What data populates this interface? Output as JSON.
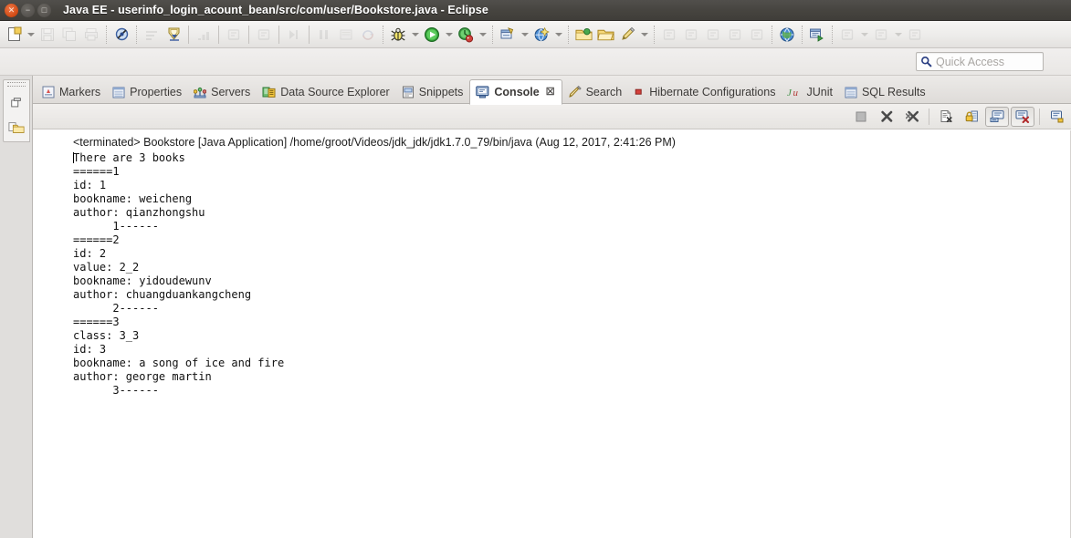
{
  "window": {
    "title": "Java EE - userinfo_login_acount_bean/src/com/user/Bookstore.java - Eclipse",
    "controls": [
      {
        "name": "close",
        "glyph": "✕"
      },
      {
        "name": "minimize",
        "glyph": "−"
      },
      {
        "name": "maximize",
        "glyph": "□"
      }
    ]
  },
  "toolbar": {
    "items": [
      {
        "name": "new-wizard-icon",
        "kind": "new",
        "enabled": true
      },
      {
        "name": "new-dropdown-arrow",
        "kind": "arrow",
        "enabled": true
      },
      {
        "name": "save-icon",
        "kind": "save",
        "enabled": false
      },
      {
        "name": "save-all-icon",
        "kind": "saveall",
        "enabled": false
      },
      {
        "name": "print-icon",
        "kind": "print",
        "enabled": false
      },
      {
        "name": "separator",
        "kind": "sep"
      },
      {
        "name": "toggle-breakpoint-icon",
        "kind": "skip",
        "enabled": true
      },
      {
        "name": "separator",
        "kind": "sep"
      },
      {
        "name": "open-type-icon",
        "kind": "opentype",
        "enabled": false
      },
      {
        "name": "validate-icon",
        "kind": "validate",
        "enabled": true
      },
      {
        "name": "separator",
        "kind": "sep-solid"
      },
      {
        "name": "run-last-tool-icon",
        "kind": "dimtool",
        "enabled": false
      },
      {
        "name": "separator",
        "kind": "sep-solid"
      },
      {
        "name": "search-dim-icon",
        "kind": "dimtool2",
        "enabled": false
      },
      {
        "name": "separator",
        "kind": "sep-solid"
      },
      {
        "name": "next-annotation-icon",
        "kind": "dimtool2",
        "enabled": false
      },
      {
        "name": "separator",
        "kind": "sep-solid"
      },
      {
        "name": "forward-icon",
        "kind": "forward",
        "enabled": false
      },
      {
        "name": "separator",
        "kind": "sep-solid"
      },
      {
        "name": "step-icon",
        "kind": "step",
        "enabled": false
      },
      {
        "name": "terminal-icon",
        "kind": "terminal",
        "enabled": false
      },
      {
        "name": "sync-icon",
        "kind": "sync",
        "enabled": false
      },
      {
        "name": "separator",
        "kind": "sep"
      },
      {
        "name": "debug-icon",
        "kind": "debug",
        "enabled": true
      },
      {
        "name": "debug-dropdown-arrow",
        "kind": "arrow",
        "enabled": true
      },
      {
        "name": "run-icon",
        "kind": "run",
        "enabled": true
      },
      {
        "name": "run-dropdown-arrow",
        "kind": "arrow",
        "enabled": true
      },
      {
        "name": "profile-icon",
        "kind": "profile",
        "enabled": true
      },
      {
        "name": "profile-dropdown-arrow",
        "kind": "arrow",
        "enabled": true
      },
      {
        "name": "separator",
        "kind": "sep"
      },
      {
        "name": "server-icon",
        "kind": "server",
        "enabled": true
      },
      {
        "name": "server-dropdown-arrow",
        "kind": "arrow",
        "enabled": true
      },
      {
        "name": "globe-blue-icon",
        "kind": "globeblue",
        "enabled": true
      },
      {
        "name": "globe-dropdown-arrow",
        "kind": "arrow",
        "enabled": true
      },
      {
        "name": "separator",
        "kind": "sep"
      },
      {
        "name": "open-folder-green-icon",
        "kind": "foldergreen",
        "enabled": true
      },
      {
        "name": "open-folder-icon",
        "kind": "folder",
        "enabled": true
      },
      {
        "name": "pencil-icon",
        "kind": "pencil",
        "enabled": true
      },
      {
        "name": "pencil-dropdown-arrow",
        "kind": "arrow",
        "enabled": true
      },
      {
        "name": "separator",
        "kind": "sep"
      },
      {
        "name": "hibernate-dim-icon",
        "kind": "dimtool2",
        "enabled": false
      },
      {
        "name": "lightning-dim-icon",
        "kind": "dimtool2",
        "enabled": false
      },
      {
        "name": "bullet-dim-icon",
        "kind": "dimtool2",
        "enabled": false
      },
      {
        "name": "table-dim-icon",
        "kind": "dimtool2",
        "enabled": false
      },
      {
        "name": "column-dim-icon",
        "kind": "dimtool2",
        "enabled": false
      },
      {
        "name": "separator",
        "kind": "sep"
      },
      {
        "name": "web-browser-icon",
        "kind": "globegreen",
        "enabled": true
      },
      {
        "name": "separator",
        "kind": "sep"
      },
      {
        "name": "deploy-icon",
        "kind": "deploy",
        "enabled": true
      },
      {
        "name": "separator",
        "kind": "sep"
      },
      {
        "name": "doc-dim-icon",
        "kind": "dimtool2",
        "enabled": false
      },
      {
        "name": "doc-dropdown-arrow",
        "kind": "arrow-dim",
        "enabled": false
      },
      {
        "name": "doc2-dim-icon",
        "kind": "dimtool2",
        "enabled": false
      },
      {
        "name": "doc2-dropdown-arrow",
        "kind": "arrow-dim",
        "enabled": false
      },
      {
        "name": "doc3-dim-icon",
        "kind": "dimtool2",
        "enabled": false
      }
    ]
  },
  "search": {
    "placeholder": "Quick Access",
    "value": "",
    "icon": "search-icon"
  },
  "fastview": {
    "items": [
      {
        "name": "restore-icon",
        "kind": "restore"
      },
      {
        "name": "project-explorer-icon",
        "kind": "folder"
      }
    ]
  },
  "tabs": [
    {
      "label": "Markers",
      "icon": "markers-icon",
      "active": false
    },
    {
      "label": "Properties",
      "icon": "properties-icon",
      "active": false
    },
    {
      "label": "Servers",
      "icon": "servers-icon",
      "active": false
    },
    {
      "label": "Data Source Explorer",
      "icon": "data-source-icon",
      "active": false
    },
    {
      "label": "Snippets",
      "icon": "snippets-icon",
      "active": false
    },
    {
      "label": "Console",
      "icon": "console-icon",
      "active": true,
      "close": "☒"
    },
    {
      "label": "Search",
      "icon": "search-tab-icon",
      "active": false
    },
    {
      "label": "Hibernate Configurations",
      "icon": "hibernate-icon",
      "active": false
    },
    {
      "label": "JUnit",
      "icon": "junit-icon",
      "active": false
    },
    {
      "label": "SQL Results",
      "icon": "sql-results-icon",
      "active": false
    }
  ],
  "console_toolbar": {
    "items": [
      {
        "name": "terminate-button",
        "kind": "terminate",
        "pressed": false
      },
      {
        "name": "remove-launch-button",
        "kind": "remove",
        "pressed": false
      },
      {
        "name": "remove-all-terminated-button",
        "kind": "removeall",
        "pressed": false
      },
      {
        "name": "separator",
        "kind": "sep"
      },
      {
        "name": "clear-console-button",
        "kind": "clear",
        "pressed": false
      },
      {
        "name": "scroll-lock-button",
        "kind": "lock",
        "pressed": false
      },
      {
        "name": "pin-console-button",
        "kind": "pin",
        "pressed": true
      },
      {
        "name": "display-selected-console-button",
        "kind": "display",
        "pressed": true
      },
      {
        "name": "separator",
        "kind": "sep"
      },
      {
        "name": "open-console-button",
        "kind": "open",
        "pressed": false
      }
    ]
  },
  "console": {
    "header": "<terminated> Bookstore [Java Application] /home/groot/Videos/jdk_jdk/jdk1.7.0_79/bin/java (Aug 12, 2017, 2:41:26 PM)",
    "lines": [
      "There are 3 books",
      "======1",
      "id: 1",
      "bookname: weicheng",
      "author: qianzhongshu",
      "      1------",
      "======2",
      "id: 2",
      "value: 2_2",
      "bookname: yidoudewunv",
      "author: chuangduankangcheng",
      "      2------",
      "======3",
      "class: 3_3",
      "id: 3",
      "bookname: a song of ice and fire",
      "author: george martin",
      "      3------"
    ]
  },
  "colors": {
    "titlebar": "#46443f",
    "toolbar": "#ecebe9",
    "console_background": "#ffffff",
    "console_text": "#111111",
    "accent_close": "#cf4913"
  }
}
